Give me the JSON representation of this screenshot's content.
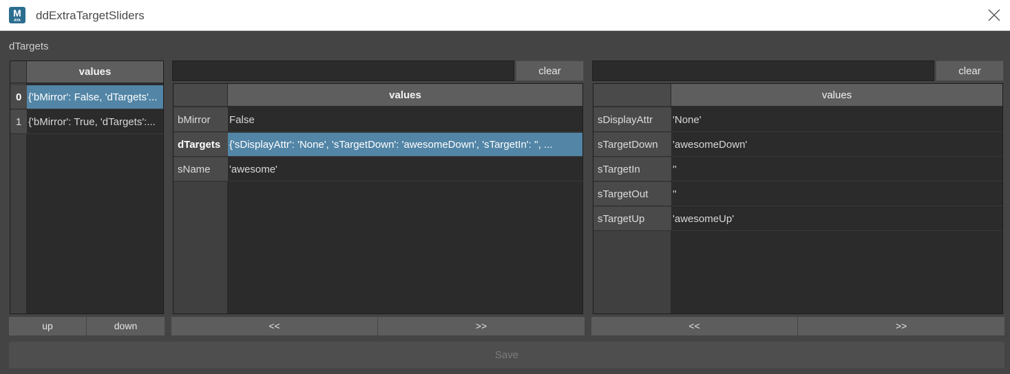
{
  "window": {
    "title": "ddExtraTargetSliders",
    "icon_label": "M",
    "icon_sub": "AYA"
  },
  "section_label": "dTargets",
  "list_panel": {
    "header": "values",
    "rows": [
      {
        "index": "0",
        "value": "{'bMirror': False, 'dTargets'...",
        "selected": true
      },
      {
        "index": "1",
        "value": "{'bMirror': True, 'dTargets':...",
        "selected": false
      }
    ],
    "up_label": "up",
    "down_label": "down"
  },
  "middle_panel": {
    "filter_value": "",
    "clear_label": "clear",
    "header": "values",
    "rows": [
      {
        "key": "bMirror",
        "value": "False",
        "selected": false
      },
      {
        "key": "dTargets",
        "value": "{'sDisplayAttr': 'None', 'sTargetDown': 'awesomeDown', 'sTargetIn': '', ...",
        "selected": true
      },
      {
        "key": "sName",
        "value": "'awesome'",
        "selected": false
      }
    ],
    "back_label": "<<",
    "forward_label": ">>"
  },
  "right_panel": {
    "filter_value": "",
    "clear_label": "clear",
    "header": "values",
    "rows": [
      {
        "key": "sDisplayAttr",
        "value": "'None'"
      },
      {
        "key": "sTargetDown",
        "value": "'awesomeDown'"
      },
      {
        "key": "sTargetIn",
        "value": "''"
      },
      {
        "key": "sTargetOut",
        "value": "''"
      },
      {
        "key": "sTargetUp",
        "value": "'awesomeUp'"
      }
    ],
    "back_label": "<<",
    "forward_label": ">>"
  },
  "save_label": "Save",
  "colors": {
    "selection": "#5285a6",
    "background": "#444444",
    "header": "#5e5e5e"
  }
}
